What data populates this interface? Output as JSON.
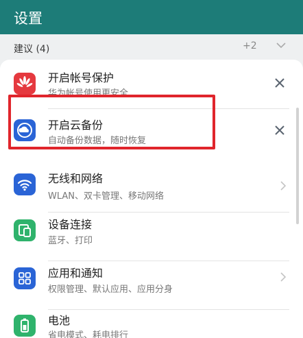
{
  "header": {
    "title": "设置"
  },
  "suggestions": {
    "label": "建议 (4)",
    "more": "+2"
  },
  "items": [
    {
      "title": "开启帐号保护",
      "subtitle": "华为帐号使用更安全",
      "icon": "huawei-logo-icon",
      "accent": "#e5393f"
    },
    {
      "title": "开启云备份",
      "subtitle": "自动备份数据，随时恢复",
      "icon": "cloud-backup-icon",
      "accent": "#2a64d6"
    },
    {
      "title": "无线和网络",
      "subtitle": "WLAN、双卡管理、移动网络",
      "icon": "wifi-icon",
      "accent": "#2a64d6"
    },
    {
      "title": "设备连接",
      "subtitle": "蓝牙、打印",
      "icon": "device-connection-icon",
      "accent": "#2fb36c"
    },
    {
      "title": "应用和通知",
      "subtitle": "权限管理、默认应用、应用分身",
      "icon": "apps-grid-icon",
      "accent": "#2a64d6"
    },
    {
      "title": "电池",
      "subtitle": "省电模式、耗电排行",
      "icon": "battery-icon",
      "accent": "#2fb36c"
    }
  ],
  "colors": {
    "header": "#1d7c78",
    "highlight": "#e0252c"
  }
}
